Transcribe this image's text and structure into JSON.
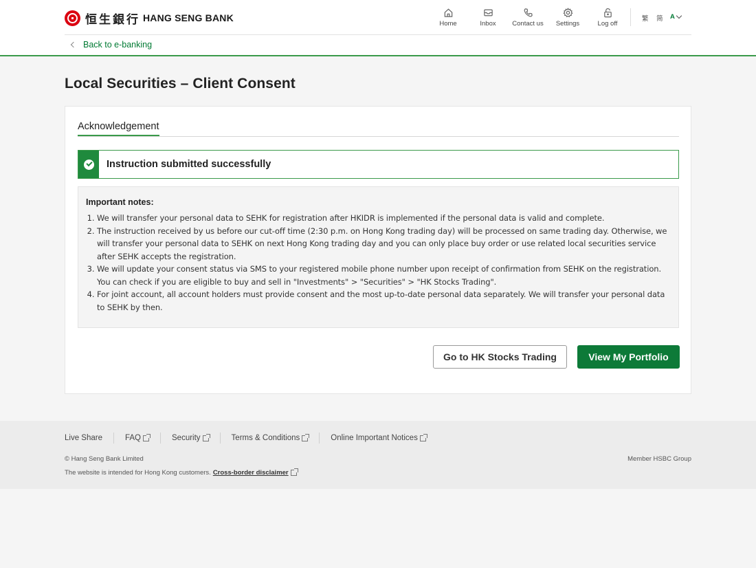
{
  "header": {
    "logo_cn": "恒生銀行",
    "logo_en": "HANG SENG BANK",
    "nav": [
      {
        "label": "Home",
        "icon": "home-icon"
      },
      {
        "label": "Inbox",
        "icon": "inbox-icon"
      },
      {
        "label": "Contact us",
        "icon": "phone-icon"
      },
      {
        "label": "Settings",
        "icon": "gear-icon"
      },
      {
        "label": "Log off",
        "icon": "lock-icon"
      }
    ],
    "languages": {
      "traditional": "繁",
      "simplified": "简",
      "font_size": "A"
    }
  },
  "back_link": "Back to e-banking",
  "page_title": "Local Securities – Client Consent",
  "tab": "Acknowledgement",
  "success_message": "Instruction submitted successfully",
  "notes": {
    "title": "Important notes:",
    "items": [
      "We will transfer your personal data to SEHK for registration after HKIDR is implemented if the personal data is valid and complete.",
      "The instruction received by us before our cut-off time (2:30 p.m. on Hong Kong trading day) will be processed on same trading day. Otherwise, we will transfer your personal data to SEHK on next Hong Kong trading day and you can only place buy order or use related local securities service after SEHK accepts the registration.",
      "We will update your consent status via SMS to your registered mobile phone number upon receipt of confirmation from SEHK on the registration. You can check if you are eligible to buy and sell in \"Investments\" > \"Securities\" > \"HK Stocks Trading\".",
      "For joint account, all account holders must provide consent and the most up-to-date personal data separately. We will transfer your personal data to SEHK by then."
    ]
  },
  "buttons": {
    "secondary": "Go to HK Stocks Trading",
    "primary": "View My Portfolio"
  },
  "footer": {
    "links": [
      "Live Share",
      "FAQ",
      "Security",
      "Terms & Conditions",
      "Online Important Notices"
    ],
    "copyright": "© Hang Seng Bank Limited",
    "member": "Member HSBC Group",
    "intended": "The website is intended for Hong Kong customers.",
    "disclaimer": "Cross-border disclaimer"
  },
  "colors": {
    "brand_green": "#0d7a38",
    "accent_green": "#3a9a4a",
    "logo_red": "#db0011"
  }
}
